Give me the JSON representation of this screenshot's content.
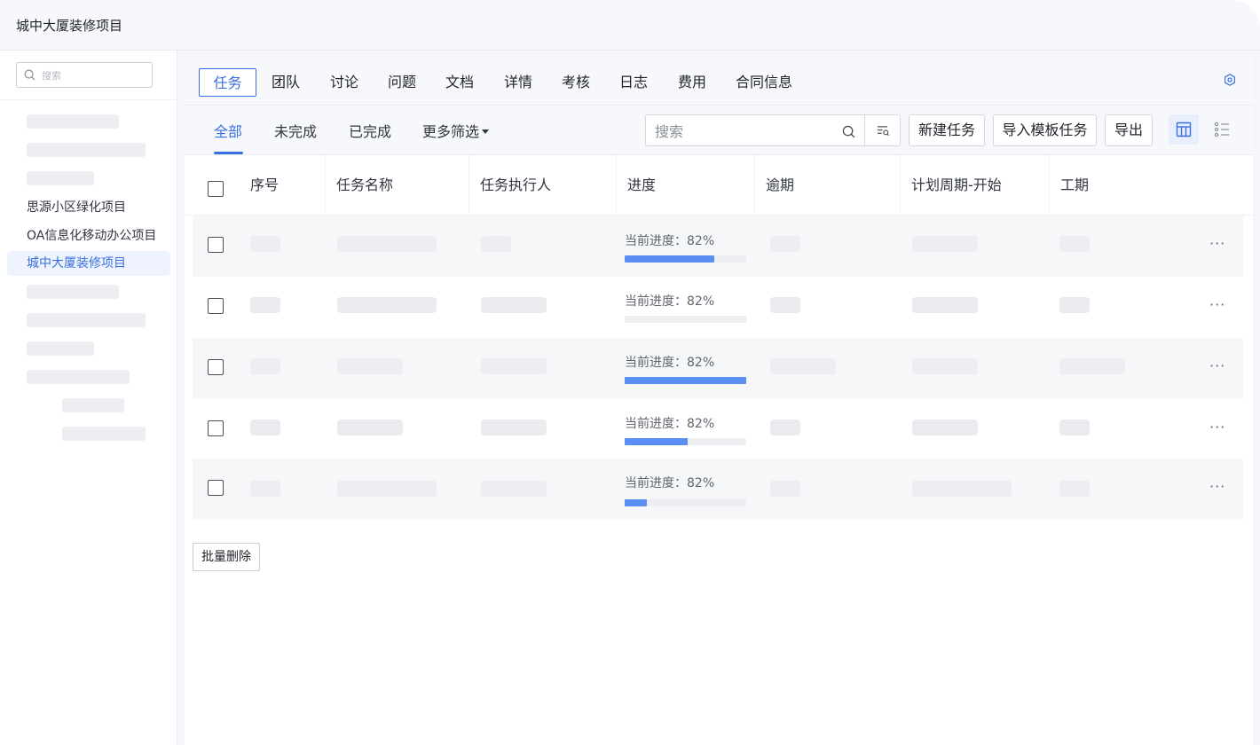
{
  "window": {
    "title": "城中大厦装修项目"
  },
  "sidebar": {
    "search_placeholder": "搜索",
    "projects": [
      {
        "label": "思源小区绿化项目",
        "active": false
      },
      {
        "label": "OA信息化移动办公项目",
        "active": false
      },
      {
        "label": "城中大厦装修项目",
        "active": true
      }
    ]
  },
  "tabs": [
    {
      "label": "任务",
      "active": true
    },
    {
      "label": "团队"
    },
    {
      "label": "讨论"
    },
    {
      "label": "问题"
    },
    {
      "label": "文档"
    },
    {
      "label": "详情"
    },
    {
      "label": "考核"
    },
    {
      "label": "日志"
    },
    {
      "label": "费用"
    },
    {
      "label": "合同信息"
    }
  ],
  "filters": {
    "tabs": [
      {
        "label": "全部",
        "active": true
      },
      {
        "label": "未完成"
      },
      {
        "label": "已完成"
      },
      {
        "label": "更多筛选"
      }
    ],
    "search_placeholder": "搜索"
  },
  "toolbar": {
    "new_task": "新建任务",
    "import_template": "导入模板任务",
    "export": "导出"
  },
  "table": {
    "columns": [
      "序号",
      "任务名称",
      "任务执行人",
      "进度",
      "逾期",
      "计划周期-开始",
      "工期"
    ],
    "rows": [
      {
        "progress_label": "当前进度：82%",
        "progress_bar": 0.74
      },
      {
        "progress_label": "当前进度：82%",
        "progress_bar": 0
      },
      {
        "progress_label": "当前进度：82%",
        "progress_bar": 1.0
      },
      {
        "progress_label": "当前进度：82%",
        "progress_bar": 0.52
      },
      {
        "progress_label": "当前进度：82%",
        "progress_bar": 0.18
      }
    ],
    "more_label": "···"
  },
  "footer": {
    "batch_delete": "批量删除"
  },
  "colors": {
    "accent": "#3a6fde",
    "progress": "#5b8ef2"
  }
}
